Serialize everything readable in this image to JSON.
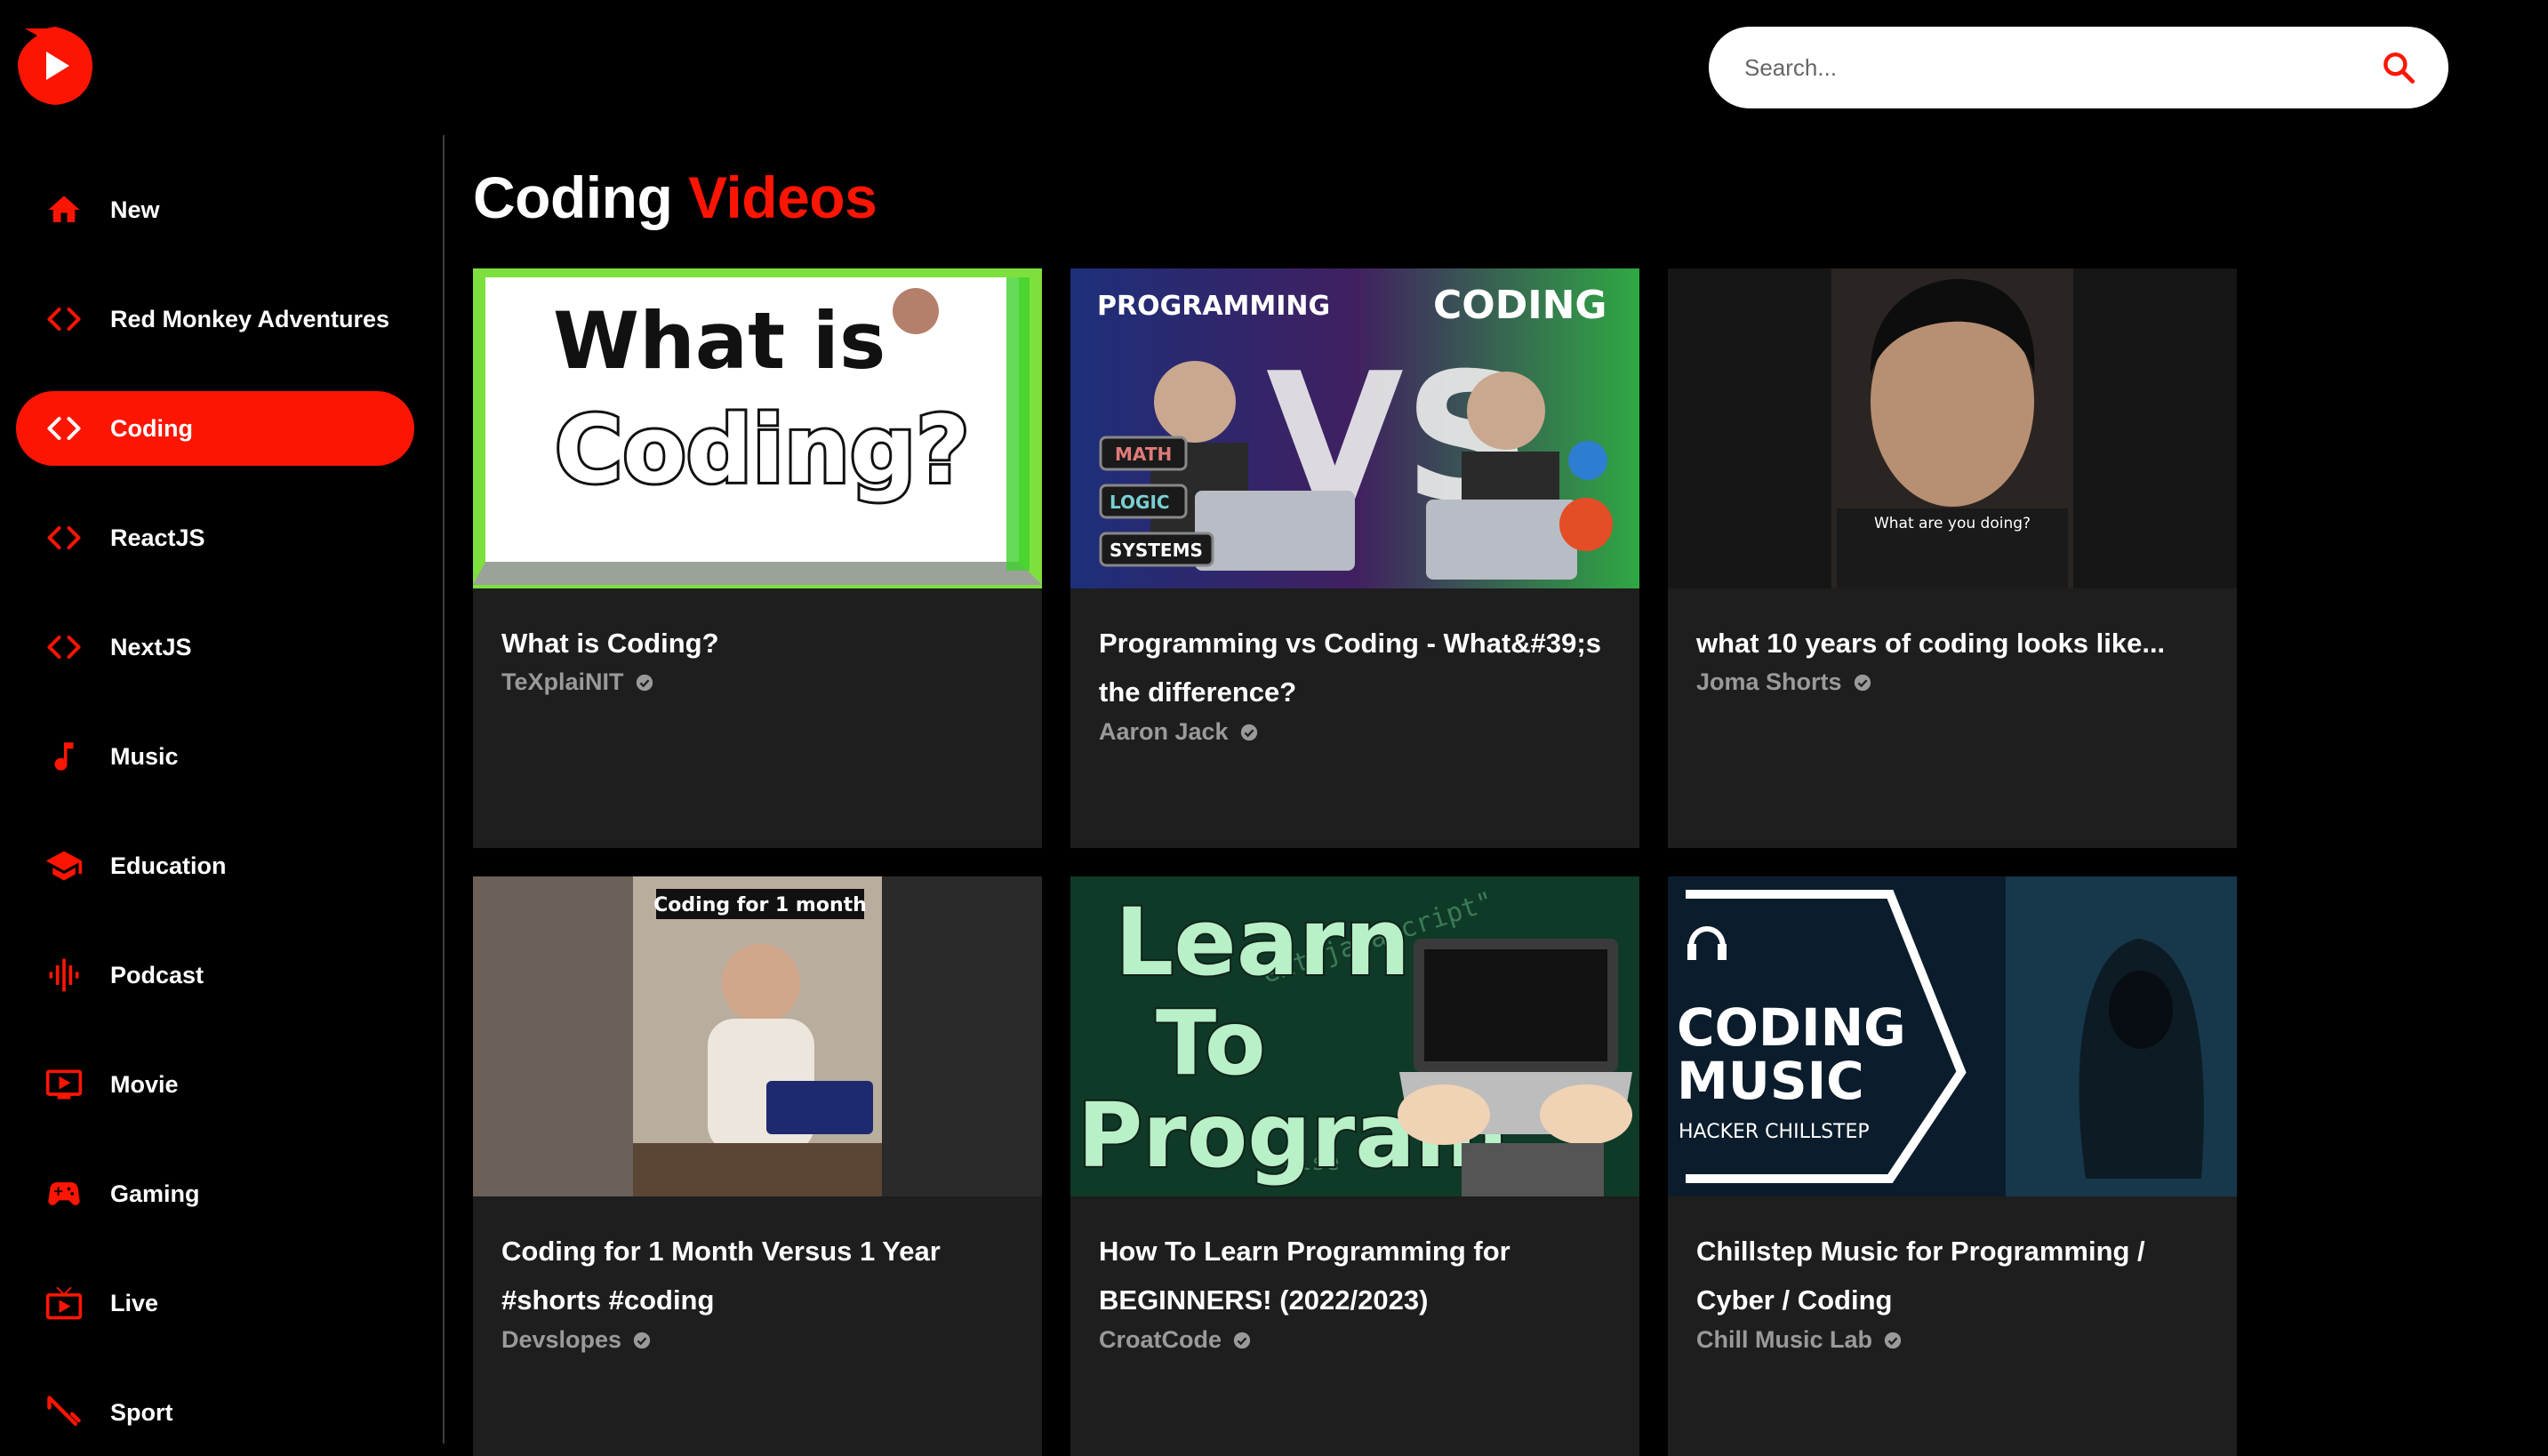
{
  "app": {
    "name": "YouTube clone"
  },
  "search": {
    "placeholder": "Search..."
  },
  "sidebar": {
    "items": [
      {
        "label": "New",
        "icon": "home-icon",
        "active": false
      },
      {
        "label": "Red Monkey Adventures",
        "icon": "code-icon",
        "active": false
      },
      {
        "label": "Coding",
        "icon": "code-icon",
        "active": true
      },
      {
        "label": "ReactJS",
        "icon": "code-icon",
        "active": false
      },
      {
        "label": "NextJS",
        "icon": "code-icon",
        "active": false
      },
      {
        "label": "Music",
        "icon": "music-note-icon",
        "active": false
      },
      {
        "label": "Education",
        "icon": "school-icon",
        "active": false
      },
      {
        "label": "Podcast",
        "icon": "graphic-eq-icon",
        "active": false
      },
      {
        "label": "Movie",
        "icon": "movie-icon",
        "active": false
      },
      {
        "label": "Gaming",
        "icon": "gamepad-icon",
        "active": false
      },
      {
        "label": "Live",
        "icon": "live-tv-icon",
        "active": false
      },
      {
        "label": "Sport",
        "icon": "sport-icon",
        "active": false
      }
    ]
  },
  "main": {
    "title_prefix": "Coding",
    "title_accent": "Videos"
  },
  "videos": [
    {
      "title": "What is Coding?",
      "channel": "TeXplaiNIT",
      "verified": true,
      "thumb_text": [
        "What is",
        "Coding?"
      ]
    },
    {
      "title": "Programming vs Coding - What&#39;s the difference?",
      "channel": "Aaron Jack",
      "verified": true,
      "thumb_text": [
        "PROGRAMMING",
        "CODING",
        "VS",
        "MATH",
        "LOGIC",
        "SYSTEMS"
      ]
    },
    {
      "title": "what 10 years of coding looks like...",
      "channel": "Joma Shorts",
      "verified": true,
      "thumb_text": [
        "What are you doing?"
      ]
    },
    {
      "title": "Coding for 1 Month Versus 1 Year #shorts #coding",
      "channel": "Devslopes",
      "verified": true,
      "thumb_text": [
        "Coding for 1 month"
      ]
    },
    {
      "title": "How To Learn Programming for BEGINNERS! (2022/2023)",
      "channel": "CroatCode",
      "verified": true,
      "thumb_text": [
        "Learn",
        "To",
        "Program"
      ]
    },
    {
      "title": "Chillstep Music for Programming / Cyber / Coding",
      "channel": "Chill Music Lab",
      "verified": true,
      "thumb_text": [
        "CODING",
        "MUSIC",
        "HACKER CHILLSTEP"
      ]
    }
  ],
  "colors": {
    "accent": "#fc1503",
    "background": "#000000",
    "card": "#1e1e1e",
    "channel_text": "#9a9a9a"
  }
}
